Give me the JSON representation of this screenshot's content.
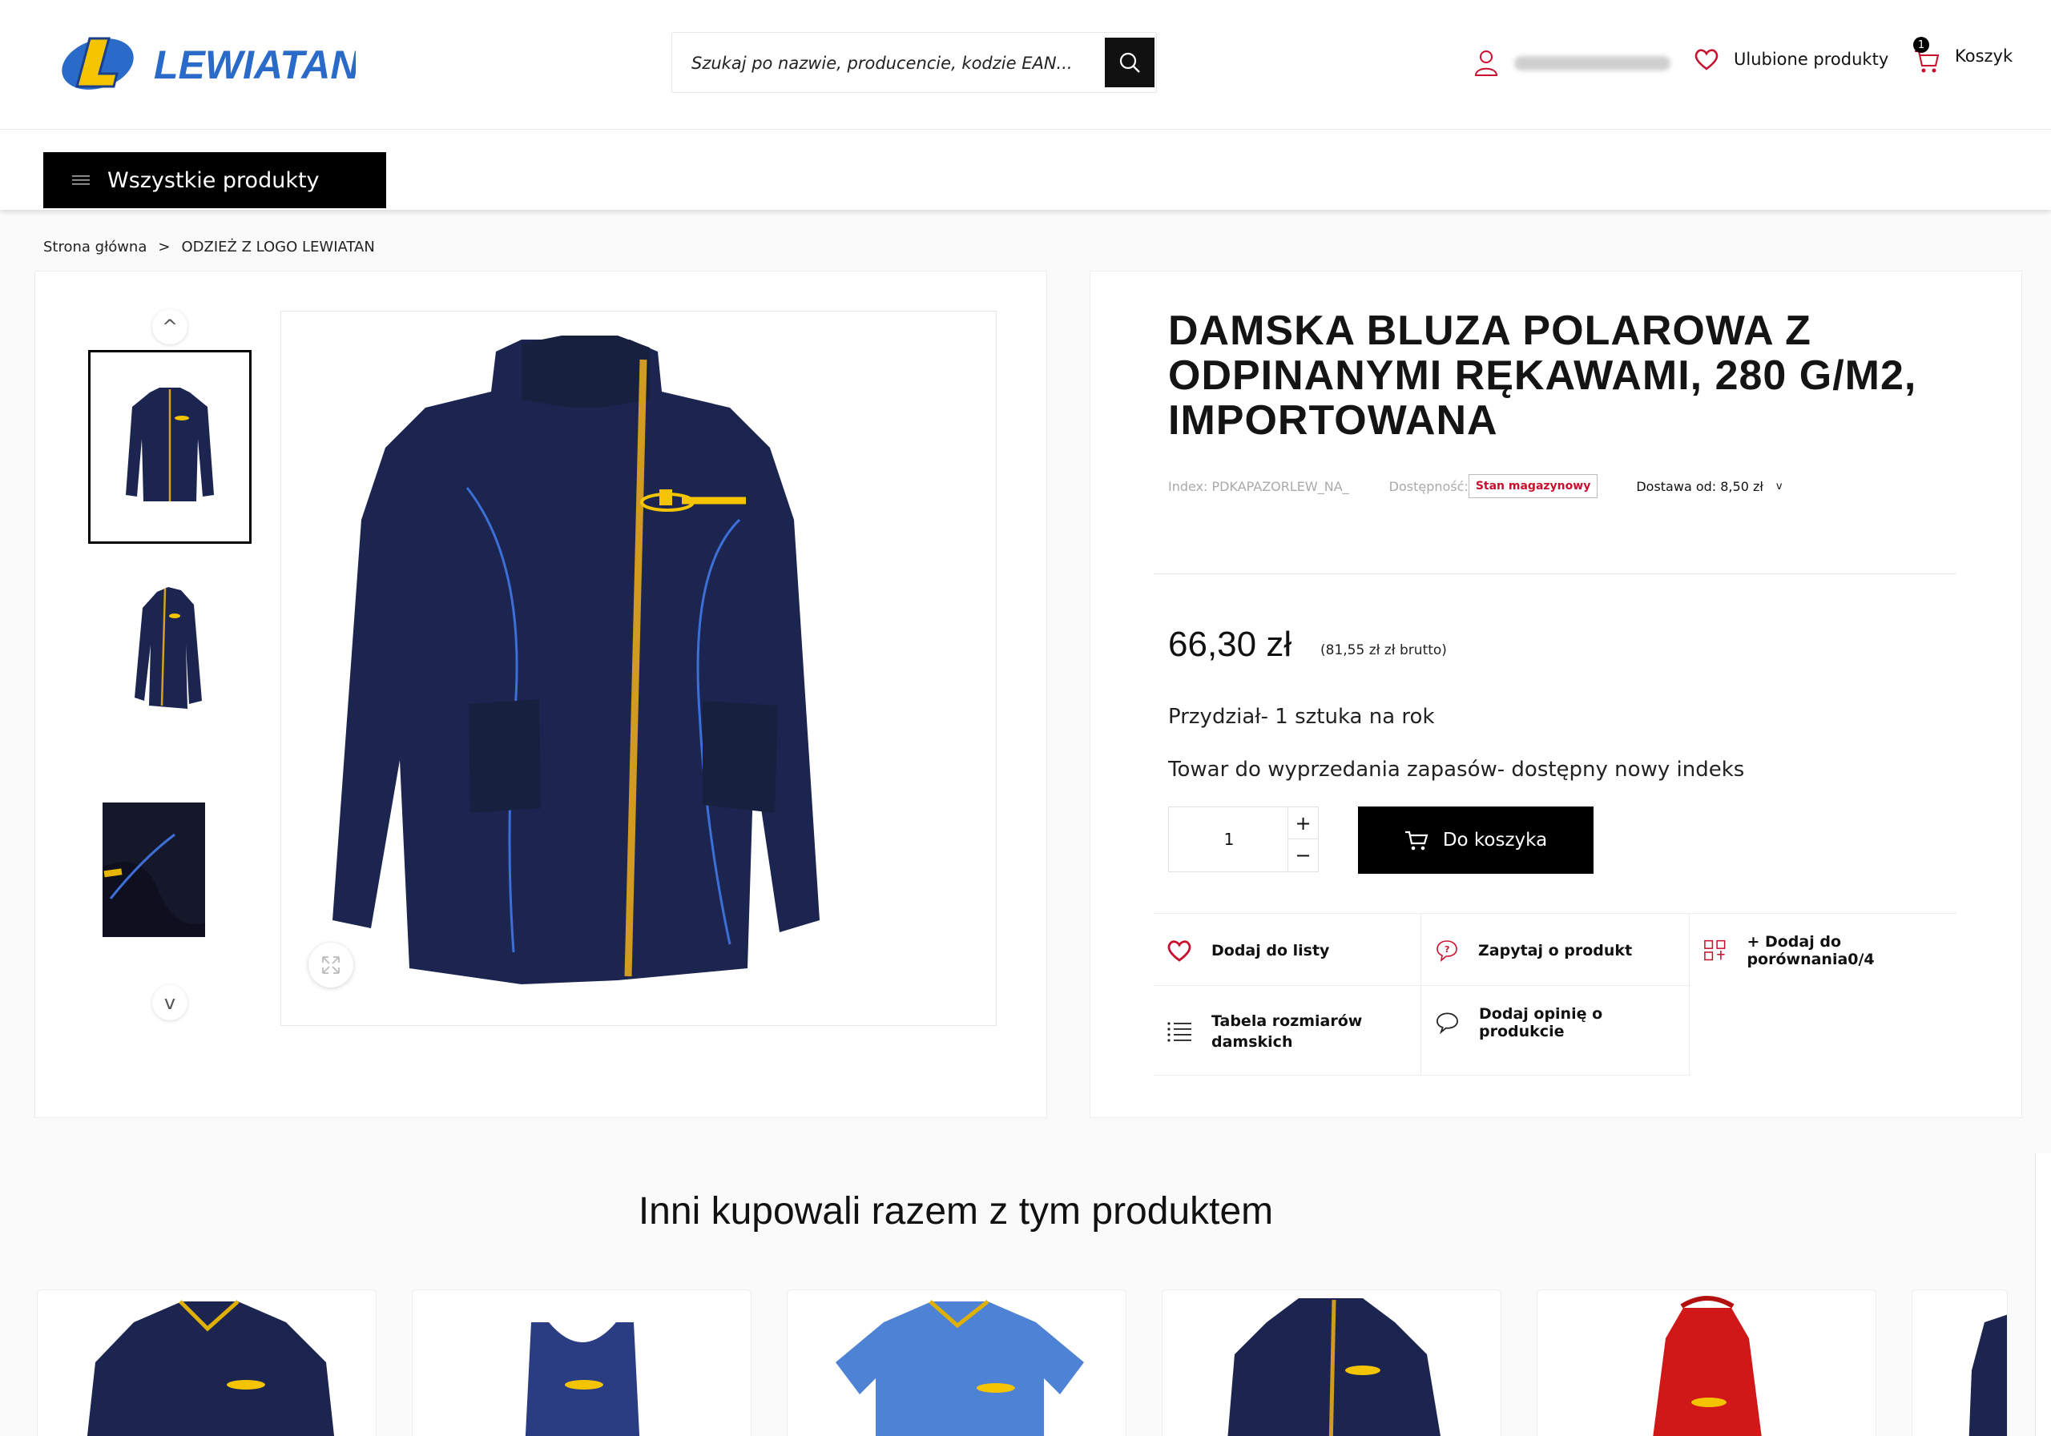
{
  "header": {
    "logo_text": "LEWIATAN",
    "search": {
      "placeholder": "Szukaj po nazwie, producencie, kodzie EAN...",
      "icon": "search-icon"
    },
    "account": {
      "icon": "user-icon"
    },
    "favorites": {
      "label": "Ulubione produkty",
      "icon": "heart-icon"
    },
    "cart": {
      "label": "Koszyk",
      "count": "1",
      "icon": "cart-icon"
    }
  },
  "nav": {
    "all_products": "Wszystkie produkty"
  },
  "breadcrumb": {
    "home": "Strona główna",
    "separator": ">",
    "current": "ODZIEŻ Z LOGO LEWIATAN"
  },
  "gallery": {
    "prev": "^",
    "next": "v"
  },
  "product": {
    "title": "DAMSKA BLUZA POLAROWA Z ODPINANYMI RĘKAWAMI, 280 G/M2, IMPORTOWANA",
    "index": "Index: PDKAPAZORLEW_NA_",
    "availability_label": "Dostępność:",
    "availability": "Stan magazynowy",
    "delivery": "Dostawa od: 8,50 zł",
    "delivery_arrow": "v",
    "price": "66,30 zł",
    "price_gross": "(81,55 zł zł brutto)",
    "note1": "Przydział- 1 sztuka na rok",
    "note2": "Towar do wyprzedania zapasów- dostępny nowy indeks",
    "quantity": "1",
    "qty_plus": "+",
    "qty_minus": "−",
    "add_to_cart": "Do koszyka"
  },
  "actions": {
    "add_to_list": "Dodaj do listy",
    "ask": "Zapytaj o produkt",
    "compare": "+ Dodaj do porównania0/4",
    "size_table_1": "Tabela rozmiarów",
    "size_table_2": "damskich",
    "review": "Dodaj opinię o produkcie"
  },
  "recommended": {
    "title": "Inni kupowali razem z tym produktem"
  },
  "colors": {
    "brand_blue": "#2a6ac8",
    "brand_yellow": "#f5c400",
    "accent_red": "#c8102e",
    "navy": "#1b2550"
  }
}
